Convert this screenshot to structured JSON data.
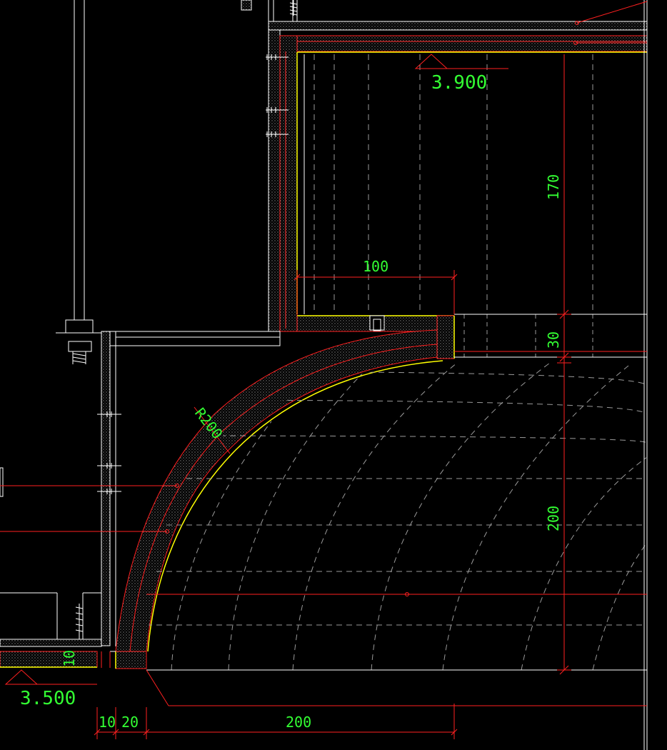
{
  "drawing": {
    "background_color": "#000000",
    "colors": {
      "outline": "#ffffff",
      "structure_red": "#ff2020",
      "finish_yellow": "#ffff00",
      "annotation_green": "#33ff33",
      "dashed_grid": "#9a9a9a"
    }
  },
  "levels": {
    "upper": "3.900",
    "lower": "3.500"
  },
  "dimensions": {
    "width_100": "100",
    "height_170": "170",
    "height_30": "30",
    "height_200": "200",
    "gap_10_vertical": "10",
    "bottom_10": "10",
    "bottom_20": "20",
    "bottom_200": "200"
  },
  "radius_label": "R200"
}
